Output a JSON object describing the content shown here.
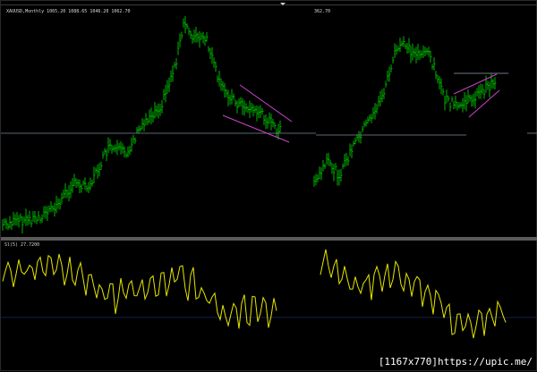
{
  "header": {
    "symbol_line": "XAUUSD,Monthly   1065.20  1088.65  1046.20  1062.70",
    "right_label": "362.70"
  },
  "indicator": {
    "label": "Sl(5) 27.7200"
  },
  "watermark": "[1167x770]https://upic.me/",
  "colors": {
    "background": "#000000",
    "bars": "#00b300",
    "indicator_line": "#e6e600",
    "channel": "#cc44cc",
    "horizontal_line": "#7a8a99",
    "separator": "#707070"
  },
  "icons": {
    "scroll": "triangle-down-icon"
  }
}
